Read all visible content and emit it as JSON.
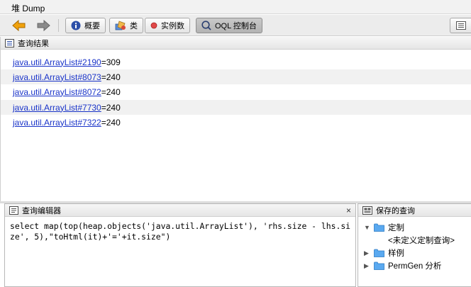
{
  "window": {
    "title": "堆 Dump"
  },
  "toolbar": {
    "summary_label": "概要",
    "classes_label": "类",
    "instances_label": "实例数",
    "oql_label": "OQL 控制台"
  },
  "results": {
    "title": "查询结果",
    "rows": [
      {
        "link": "java.util.ArrayList#2190",
        "suffix": "=309"
      },
      {
        "link": "java.util.ArrayList#8073",
        "suffix": "=240"
      },
      {
        "link": "java.util.ArrayList#8072",
        "suffix": "=240"
      },
      {
        "link": "java.util.ArrayList#7730",
        "suffix": "=240"
      },
      {
        "link": "java.util.ArrayList#7322",
        "suffix": "=240"
      }
    ]
  },
  "editor": {
    "title": "查询编辑器",
    "close_symbol": "×",
    "query": "select map(top(heap.objects('java.util.ArrayList'), 'rhs.size - lhs.size', 5),\"toHtml(it)+'='+it.size\")"
  },
  "saved": {
    "title": "保存的查询",
    "tree": [
      {
        "label": "定制",
        "expanded": true
      },
      {
        "label": "<未定义定制查询>"
      },
      {
        "label": "样例",
        "expanded": false
      },
      {
        "label": "PermGen 分析",
        "expanded": false
      }
    ]
  }
}
